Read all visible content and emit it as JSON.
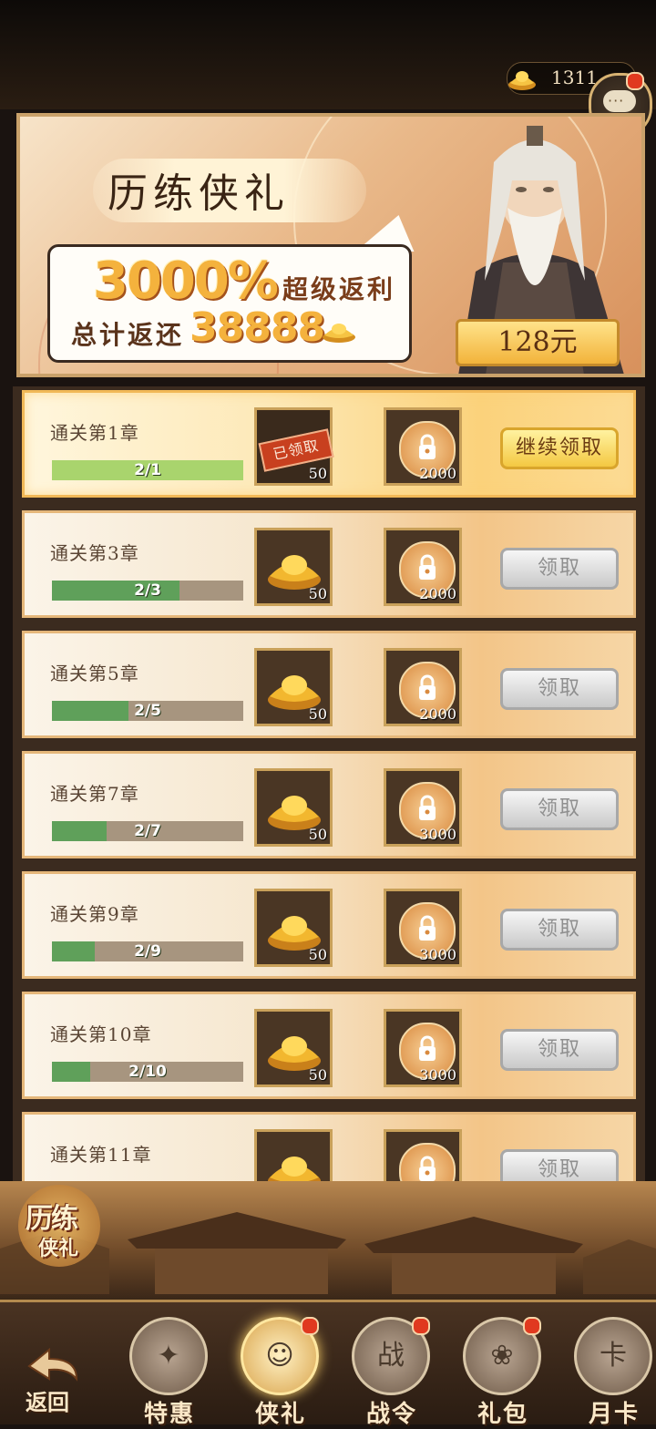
{
  "header": {
    "currency_amount": "1311",
    "currency_icon": "gold-ingot-icon",
    "chat_icon": "chat-bubble-icon",
    "chat_dots": "···"
  },
  "banner": {
    "title": "历练侠礼",
    "percent": "3000%",
    "super_text": "超级返利",
    "total_label": "总计返还",
    "total_value": "38888",
    "price": "128元"
  },
  "rows": [
    {
      "label": "通关第1章",
      "progress_text": "2/1",
      "progress": 1.0,
      "item1_qty": "50",
      "item1_claimed": true,
      "claimed_text": "已领取",
      "item2_qty": "2000",
      "action": "继续领取",
      "action_state": "active"
    },
    {
      "label": "通关第3章",
      "progress_text": "2/3",
      "progress": 0.667,
      "item1_qty": "50",
      "item2_qty": "2000",
      "action": "领取",
      "action_state": "disabled"
    },
    {
      "label": "通关第5章",
      "progress_text": "2/5",
      "progress": 0.4,
      "item1_qty": "50",
      "item2_qty": "2000",
      "action": "领取",
      "action_state": "disabled"
    },
    {
      "label": "通关第7章",
      "progress_text": "2/7",
      "progress": 0.286,
      "item1_qty": "50",
      "item2_qty": "3000",
      "action": "领取",
      "action_state": "disabled"
    },
    {
      "label": "通关第9章",
      "progress_text": "2/9",
      "progress": 0.222,
      "item1_qty": "50",
      "item2_qty": "3000",
      "action": "领取",
      "action_state": "disabled"
    },
    {
      "label": "通关第10章",
      "progress_text": "2/10",
      "progress": 0.2,
      "item1_qty": "50",
      "item2_qty": "3000",
      "action": "领取",
      "action_state": "disabled"
    },
    {
      "label": "通关第11章",
      "progress_text": "",
      "progress": 0,
      "item1_qty": "",
      "item2_qty": "",
      "action": "领取",
      "action_state": "disabled"
    }
  ],
  "event_badge": {
    "line1": "历练",
    "line2": "侠礼"
  },
  "nav": {
    "back": "返回",
    "tabs": [
      {
        "label": "特惠",
        "icon": "special-offer-icon",
        "glyph": "✦",
        "badge": false,
        "active": false
      },
      {
        "label": "侠礼",
        "icon": "hero-gift-icon",
        "glyph": "☺",
        "badge": true,
        "active": true
      },
      {
        "label": "战令",
        "icon": "battle-pass-icon",
        "glyph": "战",
        "badge": true,
        "active": false
      },
      {
        "label": "礼包",
        "icon": "gift-pack-icon",
        "glyph": "❀",
        "badge": true,
        "active": false
      },
      {
        "label": "月卡",
        "icon": "month-card-icon",
        "glyph": "卡",
        "badge": false,
        "active": false
      }
    ]
  },
  "colors": {
    "accent_gold": "#f4b23d",
    "progress_green": "#5fa05a",
    "badge_red": "#e0391f"
  }
}
